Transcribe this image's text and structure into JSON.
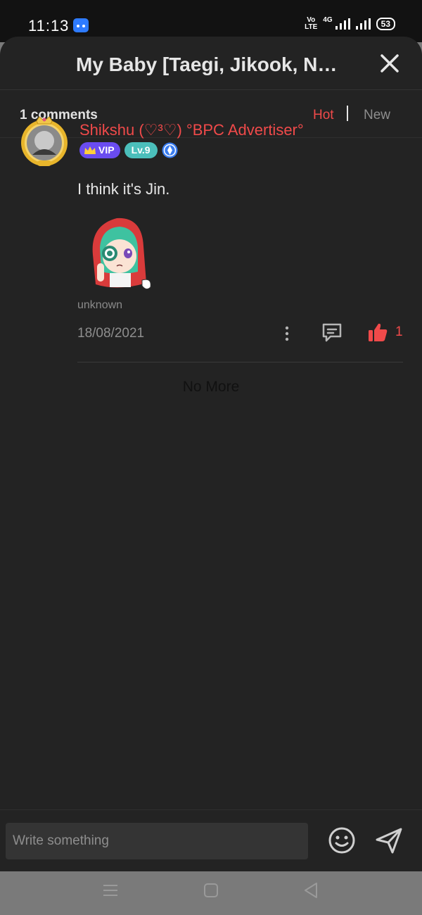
{
  "status_bar": {
    "time": "11:13",
    "network": "4G",
    "volte_label": "Vo\nLTE",
    "battery": "53"
  },
  "header": {
    "title": "My Baby [Taegi, Jikook, Na..."
  },
  "comments_bar": {
    "count_label": "1 comments",
    "sort_options": [
      "Hot",
      "New"
    ],
    "active_sort": "Hot"
  },
  "comment": {
    "author": "Shikshu (♡³♡) °BPC Advertiser°",
    "vip_label": "VIP",
    "level_label": "Lv.9",
    "text": "I think it's Jin.",
    "location": "unknown",
    "date": "18/08/2021",
    "likes": "1"
  },
  "footer_text": "No More",
  "composer": {
    "placeholder": "Write something"
  },
  "colors": {
    "accent": "#f04a4a",
    "background": "#232323",
    "vip": "#6a4cf0",
    "level": "#4bbfbb"
  },
  "icons": [
    "android-app-icon",
    "close-icon",
    "crown-icon",
    "verify-icon",
    "more-icon",
    "reply-icon",
    "thumbs-up-icon",
    "emoji-icon",
    "send-icon",
    "nav-menu-icon",
    "nav-home-icon",
    "nav-back-icon"
  ]
}
